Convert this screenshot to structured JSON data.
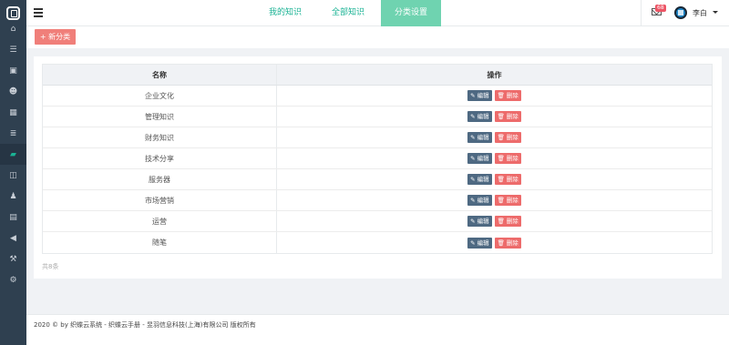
{
  "sidebar": {
    "items": [
      {
        "icon": "home-icon",
        "glyph": "⌂"
      },
      {
        "icon": "list-icon",
        "glyph": "☰"
      },
      {
        "icon": "briefcase-icon",
        "glyph": "▣"
      },
      {
        "icon": "users-icon",
        "glyph": "☻"
      },
      {
        "icon": "calendar-icon",
        "glyph": "▦"
      },
      {
        "icon": "table-icon",
        "glyph": "≣"
      },
      {
        "icon": "book-icon",
        "glyph": "▰",
        "active": true
      },
      {
        "icon": "columns-icon",
        "glyph": "◫"
      },
      {
        "icon": "user-icon",
        "glyph": "♟"
      },
      {
        "icon": "image-icon",
        "glyph": "▤"
      },
      {
        "icon": "megaphone-icon",
        "glyph": "◀"
      },
      {
        "icon": "gavel-icon",
        "glyph": "⚒"
      },
      {
        "icon": "cogs-icon",
        "glyph": "⚙"
      }
    ]
  },
  "header": {
    "tabs": [
      {
        "label": "我的知识"
      },
      {
        "label": "全部知识"
      },
      {
        "label": "分类设置",
        "active": true
      }
    ],
    "mail_count": "68",
    "username": "李白"
  },
  "toolbar": {
    "new_label": "+ 新分类"
  },
  "table": {
    "headers": [
      "名称",
      "操作"
    ],
    "rows": [
      {
        "name": "企业文化"
      },
      {
        "name": "管理知识"
      },
      {
        "name": "财务知识"
      },
      {
        "name": "技术分享"
      },
      {
        "name": "服务器"
      },
      {
        "name": "市场营销"
      },
      {
        "name": "运营"
      },
      {
        "name": "随笔"
      }
    ],
    "edit_label": "✎ 编辑",
    "delete_label": "🗑 删除",
    "total": "共8条"
  },
  "footer": {
    "text": "2020 © by 织蝶云系统 - 织蝶云手册 - 昱羽信息科技(上海)有限公司 版权所有"
  },
  "colors": {
    "sidebar": "#2f4050",
    "accent": "#1ab394",
    "active_tab": "#6fd3b0",
    "danger": "#ed6b6b",
    "edit": "#4e6982"
  }
}
